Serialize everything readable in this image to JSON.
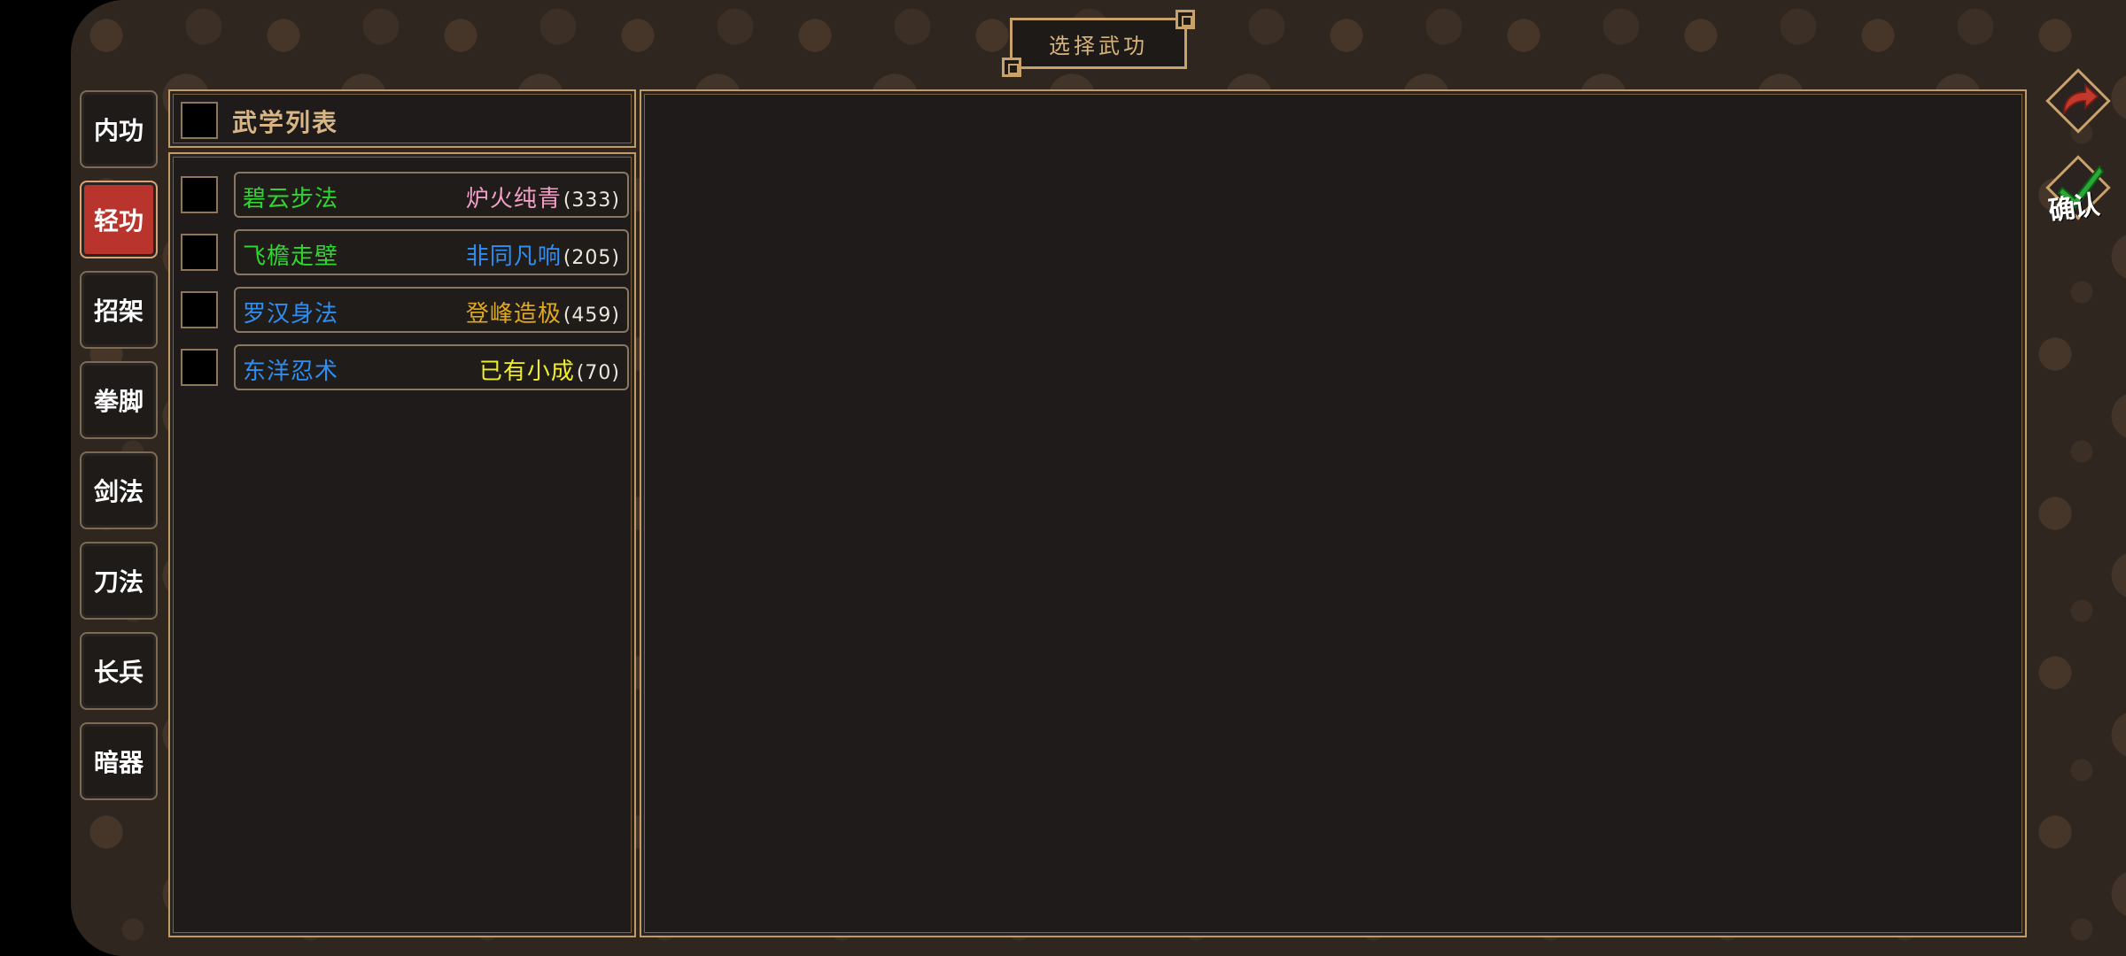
{
  "title": "选择武功",
  "categories": [
    {
      "label": "内功",
      "active": false
    },
    {
      "label": "轻功",
      "active": true
    },
    {
      "label": "招架",
      "active": false
    },
    {
      "label": "拳脚",
      "active": false
    },
    {
      "label": "剑法",
      "active": false
    },
    {
      "label": "刀法",
      "active": false
    },
    {
      "label": "长兵",
      "active": false
    },
    {
      "label": "暗器",
      "active": false
    }
  ],
  "list": {
    "header": "武学列表",
    "skills": [
      {
        "name": "碧云步法",
        "name_color": "#2fd62f",
        "level": "炉火纯青",
        "level_color": "#f3a0c8",
        "count": "(333)"
      },
      {
        "name": "飞檐走壁",
        "name_color": "#2fd62f",
        "level": "非同凡响",
        "level_color": "#2f8ef0",
        "count": "(205)"
      },
      {
        "name": "罗汉身法",
        "name_color": "#2f8ef0",
        "level": "登峰造极",
        "level_color": "#e0a820",
        "count": "(459)"
      },
      {
        "name": "东洋忍术",
        "name_color": "#2f8ef0",
        "level": "已有小成",
        "level_color": "#f0ee2a",
        "count": "(70)"
      }
    ]
  },
  "actions": {
    "back_icon": "back-arrow-icon",
    "confirm_label": "确认",
    "confirm_icon": "checkmark-icon",
    "accent_color": "#c9a26b",
    "active_tab_color": "#b8342c"
  }
}
